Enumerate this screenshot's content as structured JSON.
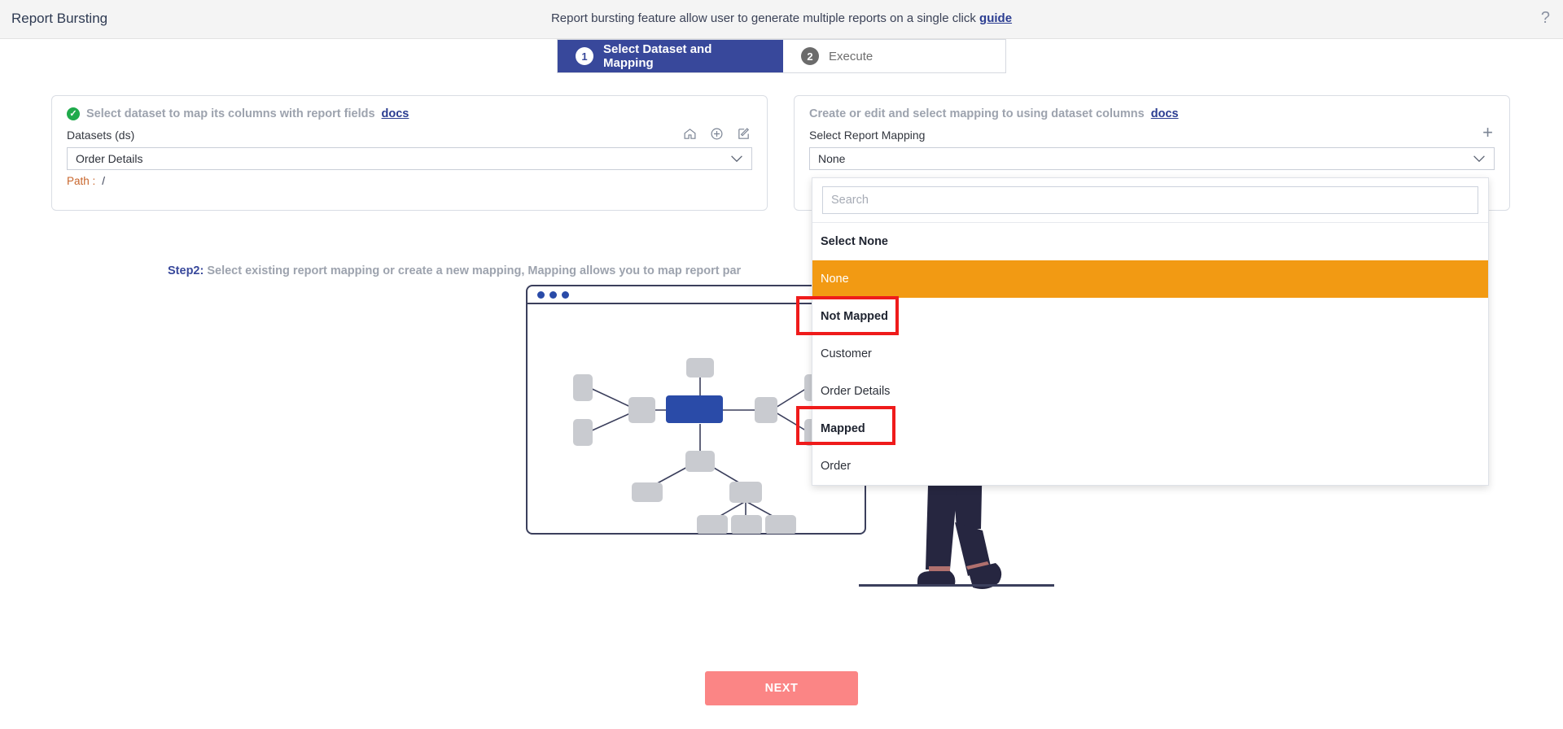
{
  "header": {
    "title": "Report Bursting",
    "description_prefix": "Report bursting feature allow user to generate multiple reports on a single click ",
    "guide_link": "guide",
    "help_icon": "question-mark-icon"
  },
  "stepper": {
    "steps": [
      {
        "number": "1",
        "label": "Select Dataset and Mapping",
        "state": "active"
      },
      {
        "number": "2",
        "label": "Execute",
        "state": "inactive"
      }
    ]
  },
  "left_panel": {
    "heading": "Select dataset to map its columns with report fields",
    "heading_link": "docs",
    "status_icon": "check-circle-icon",
    "field_label": "Datasets (ds)",
    "selected_value": "Order Details",
    "icons": [
      "home-icon",
      "plus-circle-icon",
      "edit-square-icon"
    ],
    "path_label": "Path :",
    "path_value": "/"
  },
  "right_panel": {
    "heading": "Create or edit and select mapping to using dataset columns",
    "heading_link": "docs",
    "field_label": "Select Report Mapping",
    "selected_value": "None",
    "add_icon": "plus-icon"
  },
  "dropdown": {
    "search_placeholder": "Search",
    "search_value": "",
    "items": [
      {
        "label": "Select None",
        "type": "group",
        "selected": false
      },
      {
        "label": "None",
        "type": "option",
        "selected": true
      },
      {
        "label": "Not Mapped",
        "type": "group",
        "selected": false,
        "highlighted": true
      },
      {
        "label": "Customer",
        "type": "option",
        "selected": false
      },
      {
        "label": "Order Details",
        "type": "option",
        "selected": false
      },
      {
        "label": "Mapped",
        "type": "group",
        "selected": false,
        "highlighted": true
      },
      {
        "label": "Order",
        "type": "option",
        "selected": false
      }
    ]
  },
  "step2": {
    "prefix": "Step2:",
    "text": " Select existing report mapping or create a new mapping, Mapping allows you to map report par"
  },
  "illustration": {
    "browser_dots": 3,
    "diagram_name": "node-tree-diagram",
    "person_name": "walking-person-illustration"
  },
  "footer": {
    "next_label": "NEXT"
  },
  "colors": {
    "accent_blue": "#38489b",
    "highlight_orange": "#f29a13",
    "annotation_red": "#ef1b1b",
    "next_pink": "#fb8585",
    "check_green": "#1faa4b"
  }
}
